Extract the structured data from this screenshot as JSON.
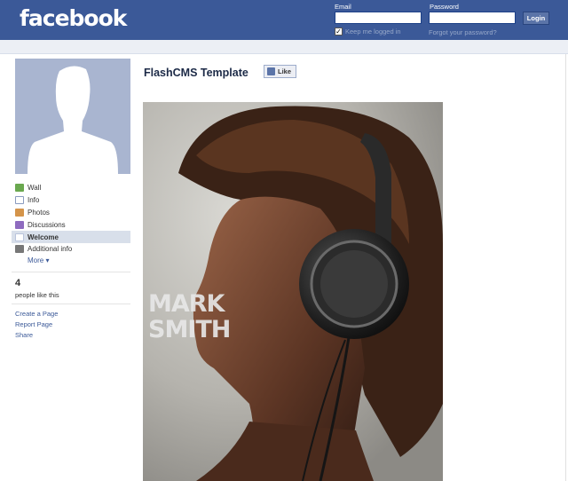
{
  "header": {
    "logo": "facebook",
    "email_label": "Email",
    "password_label": "Password",
    "email_value": "",
    "password_value": "",
    "login_label": "Login",
    "keep_logged_in_label": "Keep me logged in",
    "keep_logged_in_checked": "✓",
    "forgot_password_label": "Forgot your password?"
  },
  "sidebar": {
    "items": [
      {
        "label": "Wall",
        "icon": "wall-icon",
        "color": "#6aa84f"
      },
      {
        "label": "Info",
        "icon": "info-icon",
        "color": "#8a9bbf"
      },
      {
        "label": "Photos",
        "icon": "photos-icon",
        "color": "#d4944a"
      },
      {
        "label": "Discussions",
        "icon": "discussions-icon",
        "color": "#8e6bbf"
      },
      {
        "label": "Welcome",
        "icon": "welcome-icon",
        "color": "#ffffff"
      },
      {
        "label": "Additional info",
        "icon": "additional-info-icon",
        "color": "#777777"
      }
    ],
    "more_label": "More ▾",
    "likes_count": "4",
    "likes_text": "people like this",
    "links": [
      "Create a Page",
      "Report Page",
      "Share"
    ]
  },
  "main": {
    "page_title": "FlashCMS Template",
    "like_label": "Like",
    "photo_text_line1": "MARK",
    "photo_text_line2": "SMITH"
  },
  "colors": {
    "brand": "#3b5998",
    "active_nav": "#d8dfea"
  }
}
